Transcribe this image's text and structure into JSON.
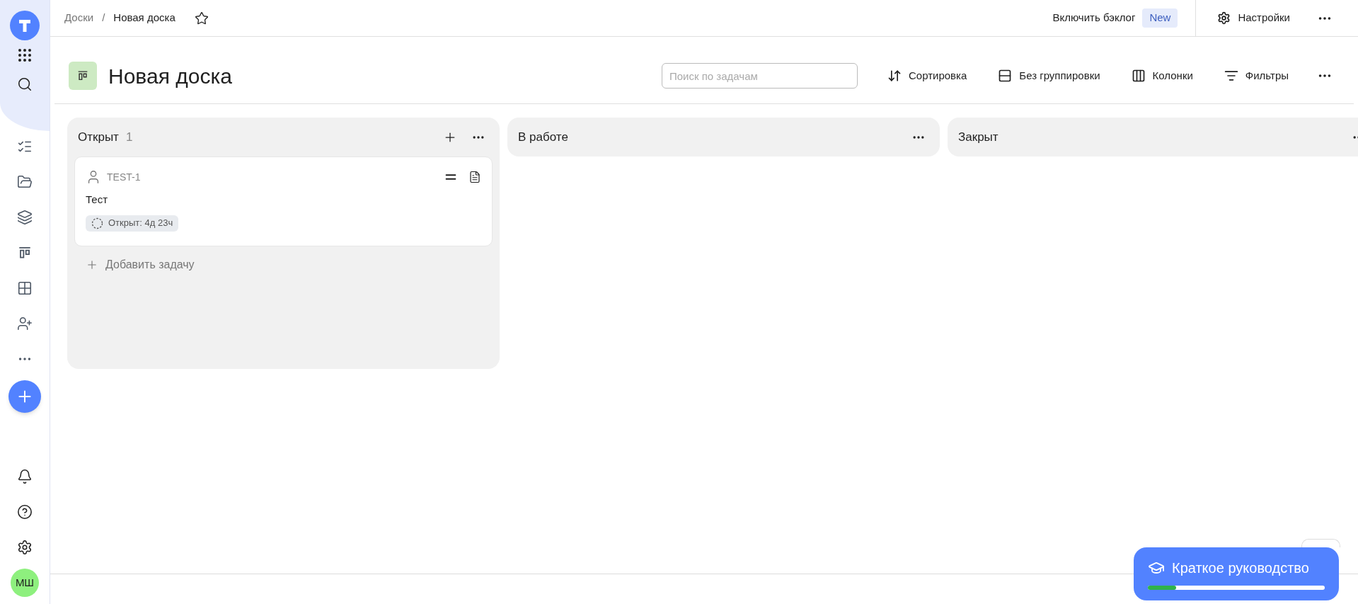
{
  "sidebar": {
    "avatar": "МШ"
  },
  "breadcrumbs": {
    "items": [
      "Доски",
      "Новая доска"
    ],
    "separator": "/",
    "starred": false
  },
  "top_actions": {
    "backlog": "Включить бэклог",
    "badge": "New",
    "settings": "Настройки"
  },
  "board": {
    "title": "Новая доска",
    "search": {
      "placeholder": "Поиск по задачам"
    },
    "toolbar": [
      {
        "kind": "sort",
        "label": "Сортировка"
      },
      {
        "kind": "group",
        "label": "Без группировки"
      },
      {
        "kind": "columns",
        "label": "Колонки"
      },
      {
        "kind": "filter",
        "label": "Фильтры"
      }
    ]
  },
  "columns": [
    {
      "title": "Открыт",
      "count": "1",
      "add_task": "Добавить задачу",
      "cards": [
        {
          "id": "TEST-1",
          "title": "Тест",
          "status": "Открыт: 4д 23ч"
        }
      ]
    },
    {
      "title": "В работе"
    },
    {
      "title": "Закрыт"
    }
  ],
  "guide": {
    "label": "Краткое руководство",
    "level": 0.16
  }
}
